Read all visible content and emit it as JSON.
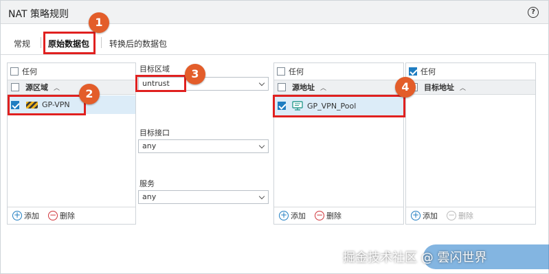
{
  "dialog": {
    "title": "NAT 策略规则",
    "help": "?"
  },
  "tabs": [
    {
      "label": "常规"
    },
    {
      "label": "原始数据包"
    },
    {
      "label": "转换后的数据包"
    }
  ],
  "source_zone": {
    "any_label": "任何",
    "any_checked": false,
    "column": "源区域",
    "sort": "^",
    "rows": [
      {
        "label": "GP-VPN",
        "checked": true
      }
    ],
    "add": "添加",
    "delete": "删除"
  },
  "middle": {
    "dest_zone_label": "目标区域",
    "dest_zone_value": "untrust",
    "dest_iface_label": "目标接口",
    "dest_iface_value": "any",
    "service_label": "服务",
    "service_value": "any"
  },
  "source_address": {
    "any_label": "任何",
    "any_checked": false,
    "column": "源地址",
    "sort": "^",
    "rows": [
      {
        "label": "GP_VPN_Pool",
        "checked": true
      }
    ],
    "add": "添加",
    "delete": "删除"
  },
  "dest_address": {
    "any_label": "任何",
    "any_checked": true,
    "column": "目标地址",
    "sort": "^",
    "add": "添加",
    "delete": "删除"
  },
  "callouts": [
    "1",
    "2",
    "3",
    "4"
  ],
  "watermark": "掘金技术社区 @ 雲闪世界",
  "colors": {
    "highlight": "#e0201f",
    "callout": "#e35d2a",
    "accent": "#1f7dc1"
  }
}
